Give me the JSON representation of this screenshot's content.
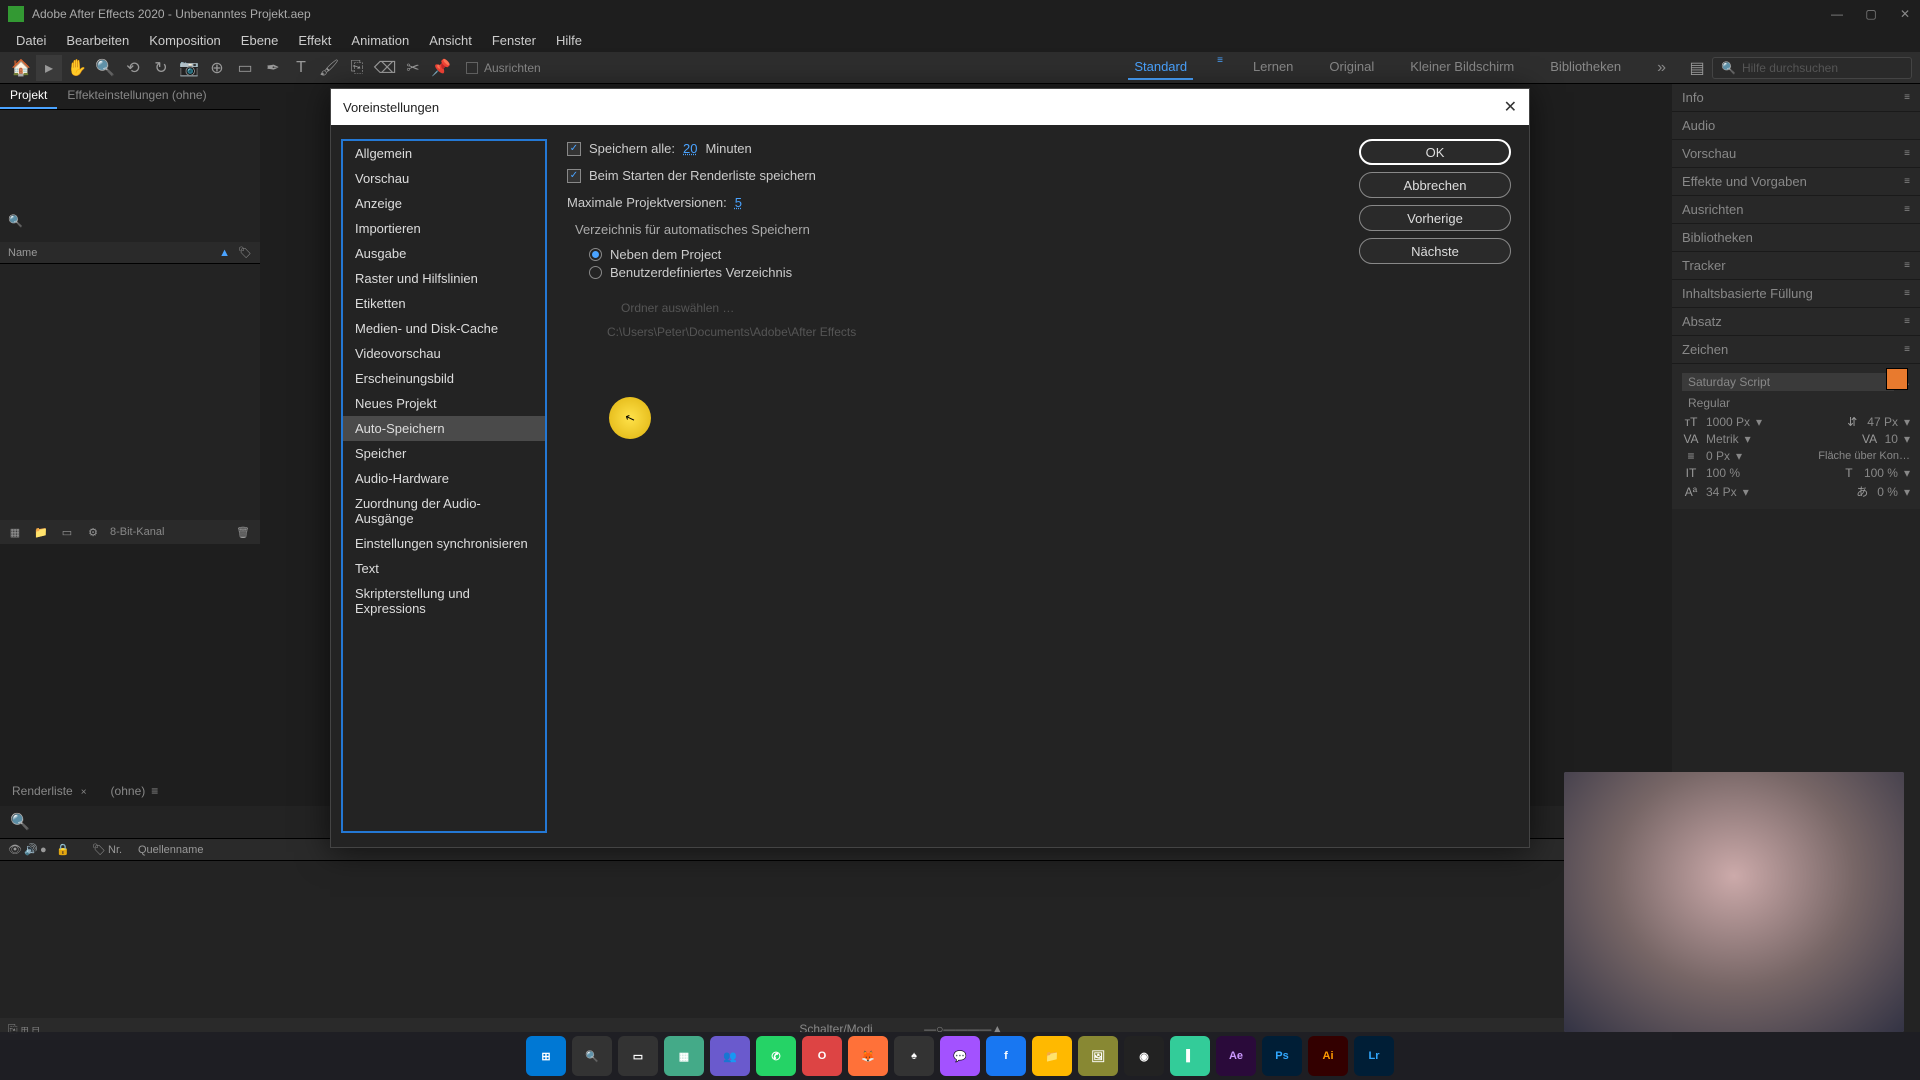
{
  "titlebar": {
    "app": "Adobe After Effects 2020 -",
    "project": "Unbenanntes Projekt.aep"
  },
  "menu": [
    "Datei",
    "Bearbeiten",
    "Komposition",
    "Ebene",
    "Effekt",
    "Animation",
    "Ansicht",
    "Fenster",
    "Hilfe"
  ],
  "toolbar": {
    "snap_label": "Ausrichten",
    "search_placeholder": "Hilfe durchsuchen"
  },
  "workspaces": {
    "items": [
      "Standard",
      "Lernen",
      "Original",
      "Kleiner Bildschirm",
      "Bibliotheken"
    ],
    "active_index": 0
  },
  "left_panel": {
    "tabs": [
      "Projekt",
      "Effekteinstellungen (ohne)"
    ],
    "name_col": "Name"
  },
  "project_footer": {
    "bit_depth": "8-Bit-Kanal"
  },
  "timeline": {
    "tabs": [
      "Renderliste",
      "(ohne)"
    ],
    "cols": {
      "nr": "Nr.",
      "quellenname": "Quellenname"
    },
    "footer": "Schalter/Modi"
  },
  "right_panels": [
    "Info",
    "Audio",
    "Vorschau",
    "Effekte und Vorgaben",
    "Ausrichten",
    "Bibliotheken",
    "Tracker",
    "Inhaltsbasierte Füllung",
    "Absatz",
    "Zeichen"
  ],
  "char_panel": {
    "font": "Saturday Script",
    "style": "Regular",
    "size": "1000 Px",
    "leading": "47 Px",
    "kerning": "Metrik",
    "tracking": "10",
    "baseline": "0 Px",
    "fill_hint": "Fläche über Kon…",
    "vscale": "100 %",
    "hscale": "100 %",
    "baseline_shift": "34 Px",
    "tsume": "0 %",
    "va": "VA"
  },
  "dialog": {
    "title": "Voreinstellungen",
    "nav": [
      "Allgemein",
      "Vorschau",
      "Anzeige",
      "Importieren",
      "Ausgabe",
      "Raster und Hilfslinien",
      "Etiketten",
      "Medien- und Disk-Cache",
      "Videovorschau",
      "Erscheinungsbild",
      "Neues Projekt",
      "Auto-Speichern",
      "Speicher",
      "Audio-Hardware",
      "Zuordnung der Audio-Ausgänge",
      "Einstellungen synchronisieren",
      "Text",
      "Skripterstellung und Expressions"
    ],
    "nav_selected": 11,
    "save_every_label": "Speichern alle:",
    "save_every_value": "20",
    "minutes": "Minuten",
    "save_on_render": "Beim Starten der Renderliste speichern",
    "max_versions_label": "Maximale Projektversionen:",
    "max_versions_value": "5",
    "dir_group": "Verzeichnis für automatisches Speichern",
    "radio_next": "Neben dem Project",
    "radio_custom": "Benutzerdefiniertes Verzeichnis",
    "choose_folder": "Ordner auswählen …",
    "path": "C:\\Users\\Peter\\Documents\\Adobe\\After Effects",
    "buttons": {
      "ok": "OK",
      "cancel": "Abbrechen",
      "prev": "Vorherige",
      "next": "Nächste"
    }
  },
  "taskbar_apps": [
    "Win",
    "Srch",
    "Task",
    "Vid",
    "Tms",
    "WA",
    "O",
    "FF",
    "?",
    "Msg",
    "FB",
    "Files",
    "Gal",
    "OBS",
    "Pr",
    "Ae",
    "Ps",
    "Ai",
    "Lr"
  ]
}
